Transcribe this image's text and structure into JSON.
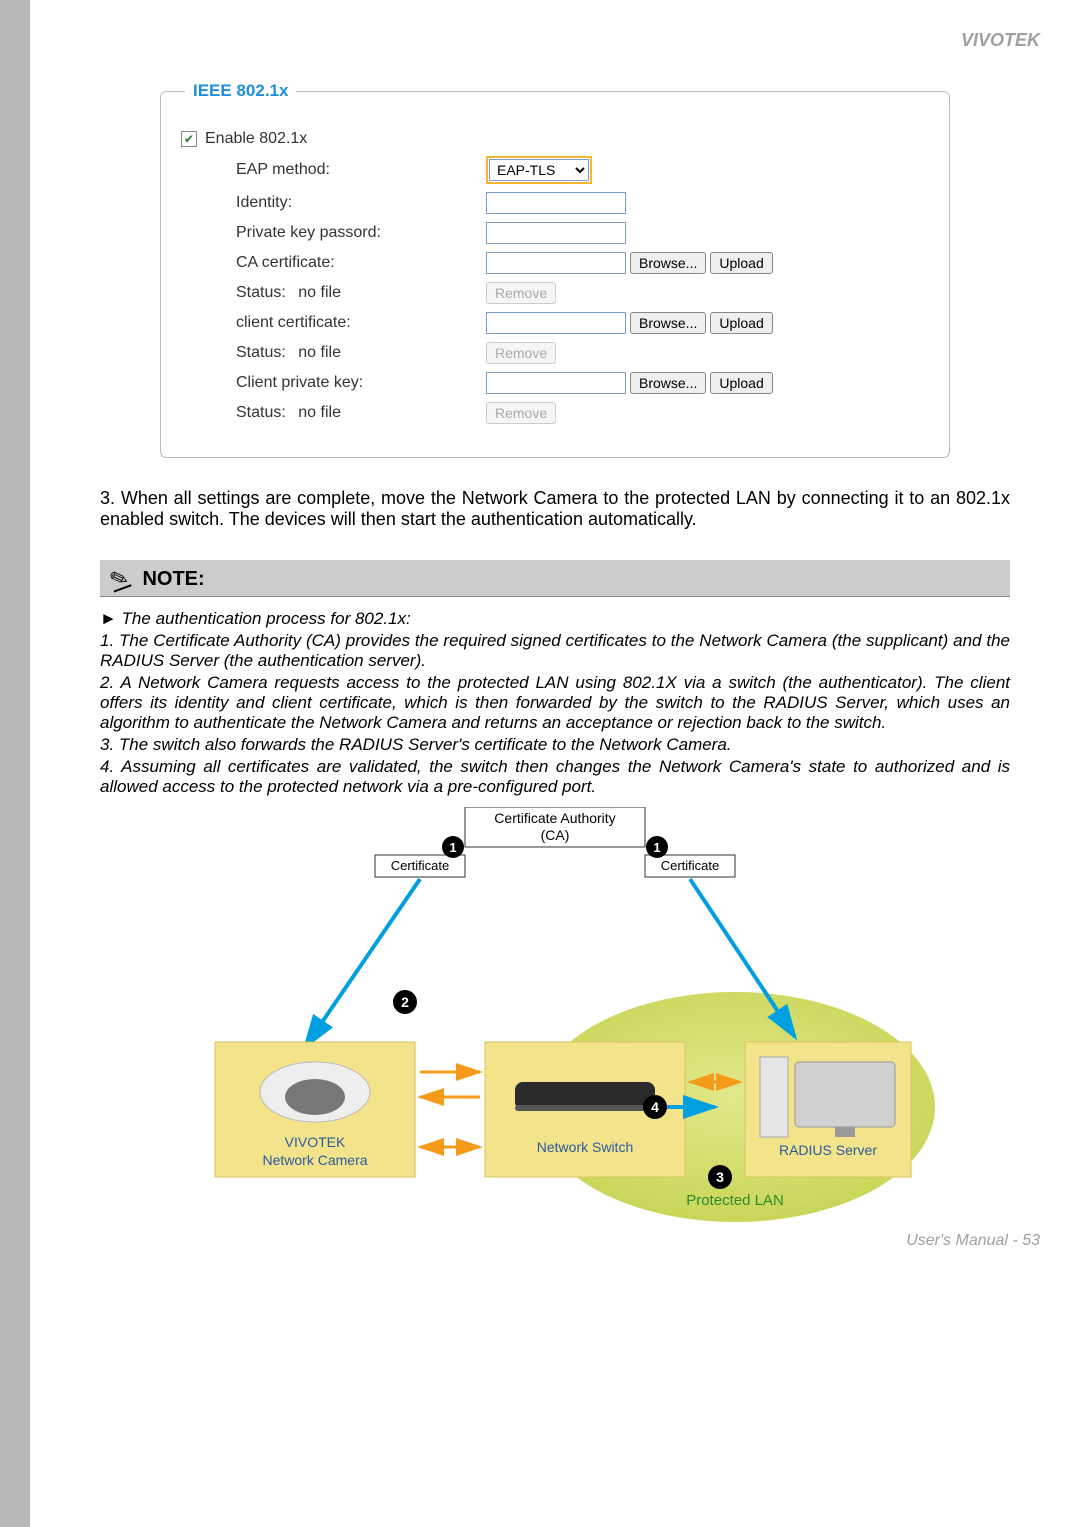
{
  "header": {
    "brand": "VIVOTEK"
  },
  "fieldset": {
    "legend": "IEEE 802.1x",
    "enable_label": "Enable 802.1x",
    "enable_checked": true,
    "rows": {
      "eap_method": {
        "label": "EAP method:",
        "value": "EAP-TLS"
      },
      "identity": {
        "label": "Identity:"
      },
      "pkp": {
        "label": "Private key passord:"
      },
      "ca_cert": {
        "label": "CA certificate:",
        "browse": "Browse...",
        "upload": "Upload"
      },
      "ca_status": {
        "label": "Status:",
        "value": "no file",
        "remove": "Remove"
      },
      "client_cert": {
        "label": "client certificate:",
        "browse": "Browse...",
        "upload": "Upload"
      },
      "cc_status": {
        "label": "Status:",
        "value": "no file",
        "remove": "Remove"
      },
      "cpk": {
        "label": "Client private key:",
        "browse": "Browse...",
        "upload": "Upload"
      },
      "cpk_status": {
        "label": "Status:",
        "value": "no file",
        "remove": "Remove"
      }
    }
  },
  "paragraph3": "3. When all settings are complete, move the Network Camera to the protected LAN by connecting it to an 802.1x enabled switch. The devices will then start the authentication automatically.",
  "note": {
    "heading": "NOTE:",
    "lines": [
      "► The authentication process for 802.1x:",
      "1. The Certificate Authority (CA) provides the required signed certificates to the Network Camera (the supplicant) and the RADIUS Server (the authentication server).",
      "2. A Network Camera requests access to the protected LAN using 802.1X via a switch (the authenticator). The client offers its identity and client certificate, which is then forwarded by the switch to the RADIUS Server, which uses an algorithm to authenticate the Network Camera and returns an acceptance or rejection back to the switch.",
      "3. The switch also forwards the RADIUS Server's certificate to the Network Camera.",
      "4. Assuming all certificates are validated, the switch then changes the Network Camera's state to authorized and is allowed access to the protected network via a pre-configured port."
    ]
  },
  "diagram": {
    "ca": "Certificate Authority\n(CA)",
    "cert": "Certificate",
    "camera": "VIVOTEK\nNetwork Camera",
    "switch": "Network Switch",
    "radius": "RADIUS Server",
    "lan": "Protected LAN",
    "n1": "1",
    "n2": "2",
    "n3": "3",
    "n4": "4"
  },
  "footer": {
    "text": "User's Manual - 53"
  }
}
